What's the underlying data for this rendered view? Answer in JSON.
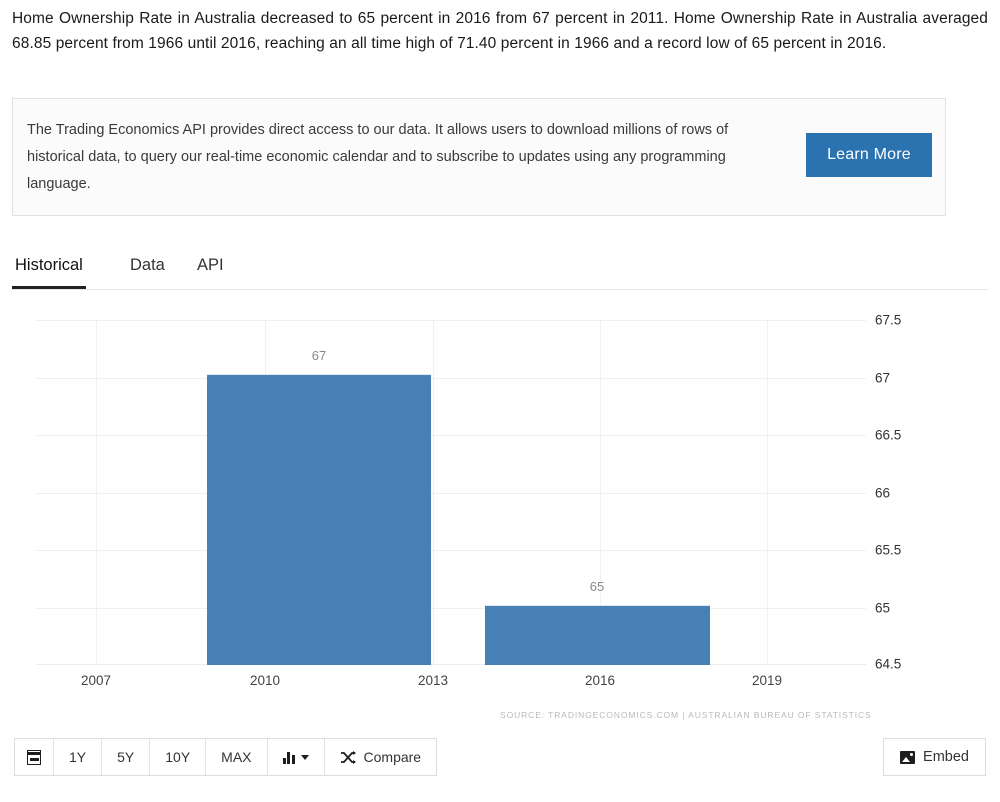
{
  "intro": {
    "text": "Home Ownership Rate in Australia decreased to 65 percent in 2016 from 67 percent in 2011. Home Ownership Rate in Australia averaged 68.85 percent from 1966 until 2016, reaching an all time high of 71.40 percent in 1966 and a record low of 65 percent in 2016."
  },
  "api_box": {
    "text": "The Trading Economics API provides direct access to our data. It allows users to download millions of rows of historical data, to query our real-time economic calendar and to subscribe to updates using any programming language.",
    "button_label": "Learn More",
    "button_color": "#2b72b0"
  },
  "tabs": [
    {
      "label": "Historical",
      "active": true
    },
    {
      "label": "Data",
      "active": false
    },
    {
      "label": "API",
      "active": false
    }
  ],
  "chart_data": {
    "type": "bar",
    "title": "",
    "xlabel": "",
    "ylabel": "",
    "categories": [
      "2011",
      "2016"
    ],
    "values": [
      67,
      65
    ],
    "data_labels": [
      "67",
      "65"
    ],
    "ylim": [
      64.5,
      67.5
    ],
    "ytick_labels": [
      "67.5",
      "67",
      "66.5",
      "66",
      "65.5",
      "65",
      "64.5"
    ],
    "ytick_values": [
      67.5,
      67,
      66.5,
      66,
      65.5,
      65,
      64.5
    ],
    "xtick_labels": [
      "2007",
      "2010",
      "2013",
      "2016",
      "2019"
    ],
    "xtick_values": [
      2007,
      2010,
      2013,
      2016,
      2019
    ],
    "xlim": [
      2005.6,
      2020.2
    ],
    "series_color": "#4680b4",
    "grid": true,
    "legend": "none",
    "source_note": "SOURCE: TRADINGECONOMICS.COM | AUSTRALIAN BUREAU OF STATISTICS"
  },
  "toolbar": {
    "calendar_icon": "calendar-icon",
    "ranges": [
      "1Y",
      "5Y",
      "10Y",
      "MAX"
    ],
    "charttype_icon": "bar-chart-icon",
    "compare_label": "Compare",
    "compare_icon": "shuffle-icon",
    "embed_label": "Embed",
    "embed_icon": "image-icon"
  }
}
